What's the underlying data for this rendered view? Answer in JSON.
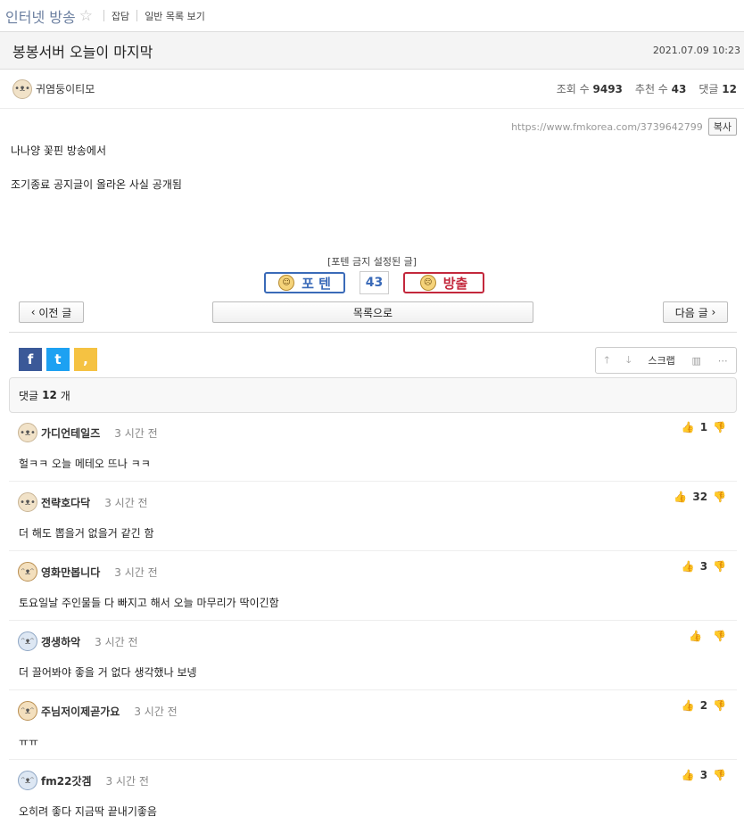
{
  "board": {
    "name": "인터넷 방송",
    "links": [
      "잡담",
      "일반 목록 보기"
    ]
  },
  "post": {
    "title": "봉봉서버 오늘이 마지막",
    "date": "2021.07.09 10:23",
    "author": "귀염둥이티모",
    "stats": {
      "views_label": "조회 수",
      "views": "9493",
      "recommend_label": "추천 수",
      "recommend": "43",
      "comments_label": "댓글",
      "comments": "12"
    },
    "url": "https://www.fmkorea.com/3739642799",
    "copy_label": "복사",
    "body": [
      "나나양 꽃핀 방송에서",
      "조기종료 공지글이 올라온 사실 공개됨"
    ]
  },
  "vote": {
    "notice": "[포텐 금지 설정된 글]",
    "up_label": "포 텐",
    "count": "43",
    "down_label": "방출"
  },
  "nav": {
    "prev": "이전 글",
    "list": "목록으로",
    "next": "다음 글"
  },
  "share": {
    "facebook": "f",
    "twitter": "t",
    "kakaostory": ","
  },
  "tools": {
    "scrap": "스크랩"
  },
  "comments_header": {
    "label_pre": "댓글",
    "count": "12",
    "label_post": "개"
  },
  "comments": [
    {
      "nick": "가디언테일즈",
      "time": "3 시간 전",
      "text": "헐ㅋㅋ 오늘 메테오 뜨나 ㅋㅋ",
      "likes": "1",
      "avatar": "puppy-icon"
    },
    {
      "nick": "전략호다닥",
      "time": "3 시간 전",
      "text": "더 해도 뽑을거 없을거 같긴 함",
      "likes": "32",
      "avatar": "puppy-icon"
    },
    {
      "nick": "영화만봅니다",
      "time": "3 시간 전",
      "text": "토요일날 주인물들 다 빠지고 해서 오늘 마무리가 딱이긴함",
      "likes": "3",
      "avatar": "chihuahua-icon"
    },
    {
      "nick": "갱생하악",
      "time": "3 시간 전",
      "text": "더 끌어봐야 좋을 거 없다 생각했나 보넹",
      "likes": "",
      "avatar": "pomeranian-icon"
    },
    {
      "nick": "주님저이제곧가요",
      "time": "3 시간 전",
      "text": "ㅠㅠ",
      "likes": "2",
      "avatar": "chihuahua-icon"
    },
    {
      "nick": "fm22갓겜",
      "time": "3 시간 전",
      "text": "오히려 좋다 지금딱 끝내기좋음",
      "likes": "3",
      "avatar": "pomeranian-icon"
    }
  ]
}
